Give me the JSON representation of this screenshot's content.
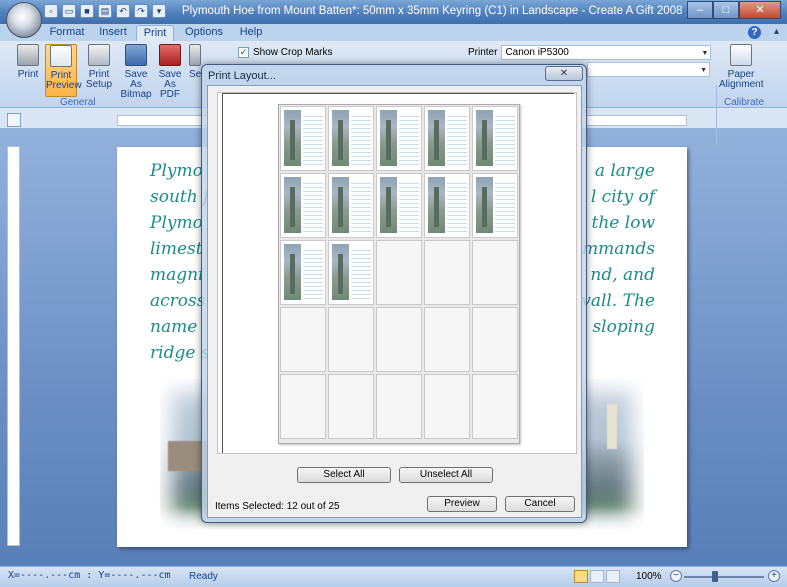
{
  "app": {
    "title": "Plymouth Hoe from Mount Batten*: 50mm x 35mm Keyring (C1) in Landscape - Create A Gift 2008",
    "quick_access": [
      "new-icon",
      "open-icon",
      "save-icon",
      "print-icon",
      "undo-icon",
      "redo-icon",
      "customize-icon"
    ],
    "win_controls": {
      "minimize": "–",
      "maximize": "□",
      "close": "✕"
    }
  },
  "tabs": [
    {
      "label": "Format",
      "active": false
    },
    {
      "label": "Insert",
      "active": false
    },
    {
      "label": "Print",
      "active": true
    },
    {
      "label": "Options",
      "active": false
    },
    {
      "label": "Help",
      "active": false
    }
  ],
  "ribbon": {
    "buttons": [
      {
        "label1": "Print",
        "label2": ""
      },
      {
        "label1": "Print",
        "label2": "Preview",
        "active": true
      },
      {
        "label1": "Print",
        "label2": "Setup"
      },
      {
        "label1": "Save As",
        "label2": "Bitmap"
      },
      {
        "label1": "Save",
        "label2": "As PDF"
      },
      {
        "label1": "Se",
        "label2": ""
      }
    ],
    "show_crop_marks_label": "Show Crop Marks",
    "show_crop_marks_checked": true,
    "printer_label": "Printer",
    "printer_value": "Canon iP5300",
    "group_general": "General",
    "paper_alignment": {
      "label1": "Paper",
      "label2": "Alignment"
    },
    "group_calibrate": "Calibrate"
  },
  "document": {
    "lines": [
      {
        "left": "Plymo",
        "right": "a  large"
      },
      {
        "left": "south f",
        "right": "l city of"
      },
      {
        "left": "Plymo",
        "right": "the  low"
      },
      {
        "left": "limest",
        "right": "mmands"
      },
      {
        "left": "magni",
        "right": "nd, and"
      },
      {
        "left": "across",
        "right": "vall.  The"
      },
      {
        "left": "name",
        "right": "sloping"
      },
      {
        "left": "ridge s",
        "right": ""
      }
    ]
  },
  "dialog": {
    "title": "Print Layout...",
    "close": "✕",
    "grid_rows": 5,
    "grid_cols": 5,
    "selected_count": 12,
    "select_all": "Select All",
    "unselect_all": "Unselect All",
    "items_selected": "Items Selected:  12 out of 25",
    "preview": "Preview",
    "cancel": "Cancel"
  },
  "status": {
    "coords": "X=----.---cm : Y=----.---cm",
    "ready": "Ready",
    "zoom": "100%",
    "zoom_minus": "−",
    "zoom_plus": "+"
  }
}
